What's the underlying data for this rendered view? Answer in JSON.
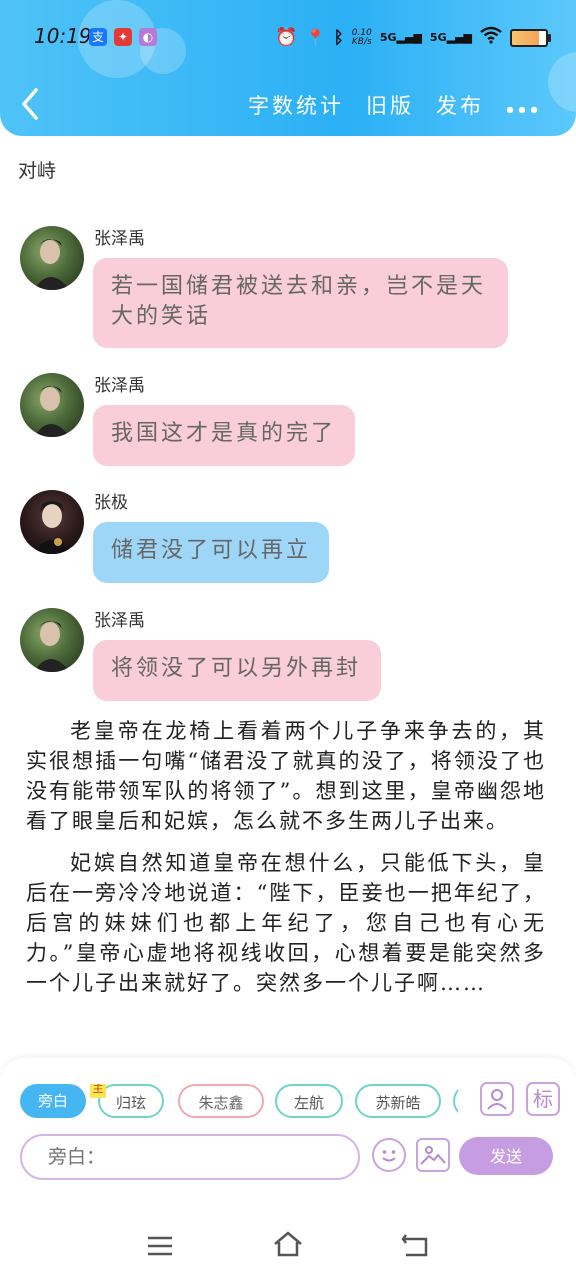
{
  "status_bar": {
    "time": "10:19",
    "net_speed_value": "0.10",
    "net_speed_unit": "KB/s",
    "sim1": "5G",
    "sim2": "5G"
  },
  "nav": {
    "items": [
      "字数统计",
      "旧版",
      "发布"
    ]
  },
  "chapter_title": "对峙",
  "messages": [
    {
      "speaker": "张泽禹",
      "text": "若一国储君被送去和亲，岂不是天大的笑话"
    },
    {
      "speaker": "张泽禹",
      "text": "我国这才是真的完了"
    },
    {
      "speaker": "张极",
      "text": "储君没了可以再立"
    },
    {
      "speaker": "张泽禹",
      "text": "将领没了可以另外再封"
    }
  ],
  "narration": [
    "老皇帝在龙椅上看着两个儿子争来争去的，其实很想插一句嘴“储君没了就真的没了，将领没了也没有能带领军队的将领了”。想到这里，皇帝幽怨地看了眼皇后和妃嫔，怎么就不多生两儿子出来。",
    "妃嫔自然知道皇帝在想什么，只能低下头，皇后在一旁冷冷地说道：“陛下，臣妾也一把年纪了，后宫的妹妹们也都上年纪了，您自己也有心无力。”皇帝心虚地将视线收回，心想着要是能突然多一个儿子出来就好了。突然多一个儿子啊……"
  ],
  "role_chips": [
    "旁白",
    "归玹",
    "朱志鑫",
    "左航",
    "苏新皓"
  ],
  "main_badge": "主",
  "mark_button_label": "标",
  "input": {
    "placeholder": "旁白："
  },
  "send_label": "发送",
  "colors": {
    "header": "#2bb0f5",
    "pink_bubble": "#f9cdd9",
    "blue_bubble": "#9ed6f7",
    "send_button": "#c79de2",
    "active_chip": "#45b6f2"
  }
}
